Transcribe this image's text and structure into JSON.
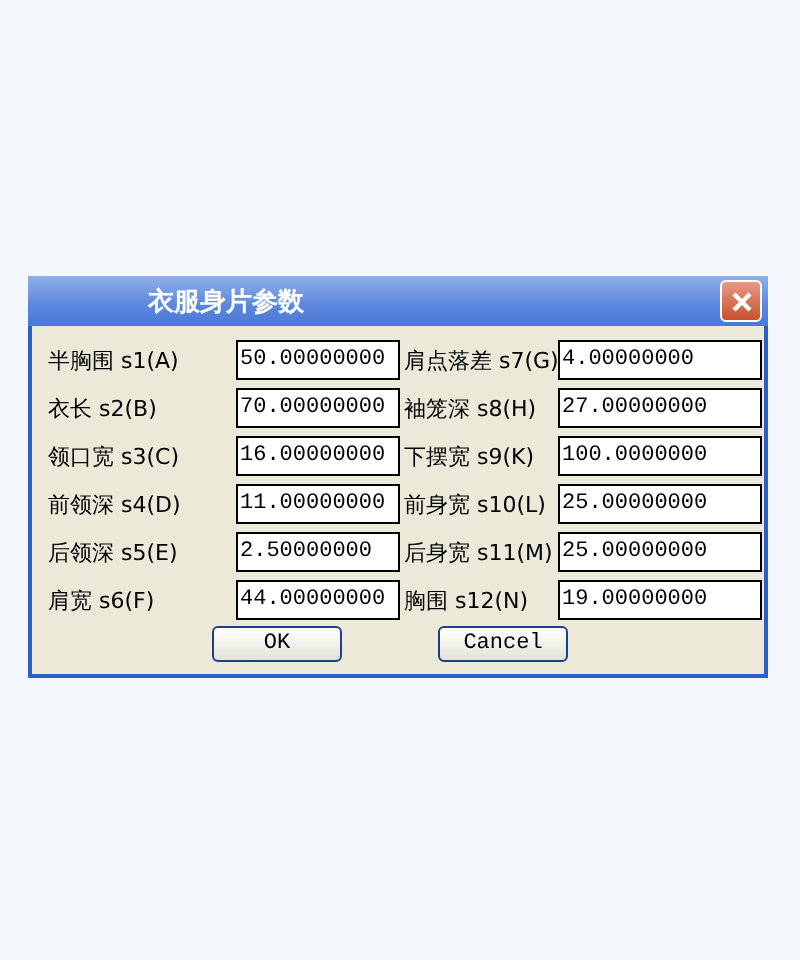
{
  "window": {
    "title": "衣服身片参数"
  },
  "fields": [
    {
      "label": "半胸围 s1(A)",
      "value": "50.00000000"
    },
    {
      "label": "肩点落差 s7(G)",
      "value": "4.00000000"
    },
    {
      "label": "衣长 s2(B)",
      "value": "70.00000000"
    },
    {
      "label": "袖笼深 s8(H)",
      "value": "27.00000000"
    },
    {
      "label": "领口宽 s3(C)",
      "value": "16.00000000"
    },
    {
      "label": "下摆宽 s9(K)",
      "value": "100.0000000"
    },
    {
      "label": "前领深 s4(D)",
      "value": "11.00000000"
    },
    {
      "label": "前身宽 s10(L)",
      "value": "25.00000000"
    },
    {
      "label": "后领深 s5(E)",
      "value": "2.50000000"
    },
    {
      "label": "后身宽 s11(M)",
      "value": "25.00000000"
    },
    {
      "label": "肩宽 s6(F)",
      "value": "44.00000000"
    },
    {
      "label": "胸围 s12(N)",
      "value": "19.00000000"
    }
  ],
  "buttons": [
    "OK",
    "Cancel"
  ]
}
